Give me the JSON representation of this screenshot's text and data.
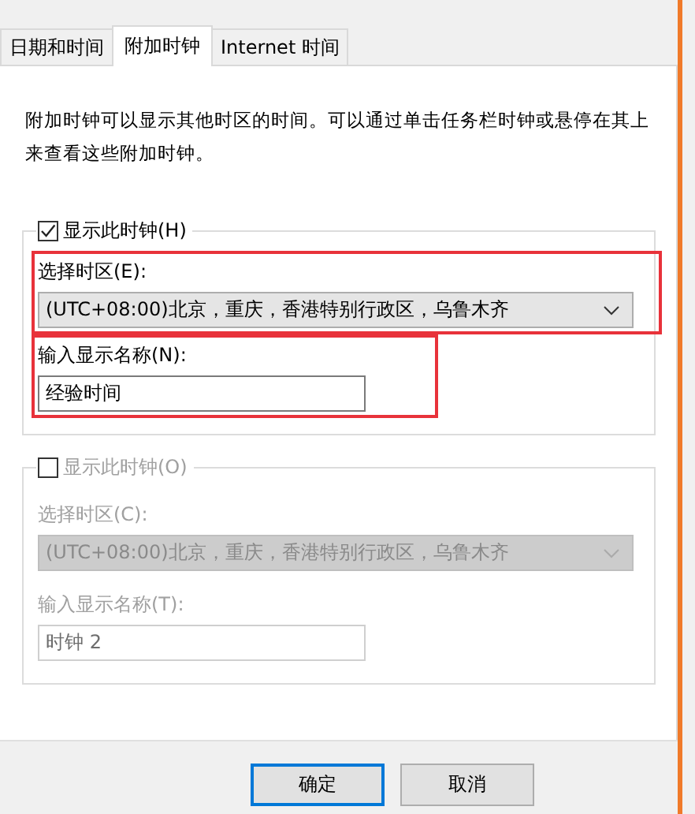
{
  "tabs": [
    {
      "label": "日期和时间",
      "selected": false
    },
    {
      "label": "附加时钟",
      "selected": true
    },
    {
      "label": "Internet 时间",
      "selected": false
    }
  ],
  "description": "附加时钟可以显示其他时区的时间。可以通过单击任务栏时钟或悬停在其上来查看这些附加时钟。",
  "clocks": [
    {
      "checkbox_label": "显示此时钟(H)",
      "checked": true,
      "timezone": {
        "label": "选择时区(E):",
        "value": "(UTC+08:00)北京，重庆，香港特别行政区，乌鲁木齐",
        "highlighted": true
      },
      "display_name": {
        "label": "输入显示名称(N):",
        "value": "经验时间",
        "highlighted": true
      }
    },
    {
      "checkbox_label": "显示此时钟(O)",
      "checked": false,
      "timezone": {
        "label": "选择时区(C):",
        "value": "(UTC+08:00)北京，重庆，香港特别行政区，乌鲁木齐",
        "highlighted": false
      },
      "display_name": {
        "label": "输入显示名称(T):",
        "value": "时钟 2",
        "highlighted": false
      }
    }
  ],
  "buttons": [
    {
      "label": "确定",
      "default": true
    },
    {
      "label": "取消",
      "default": false
    }
  ]
}
